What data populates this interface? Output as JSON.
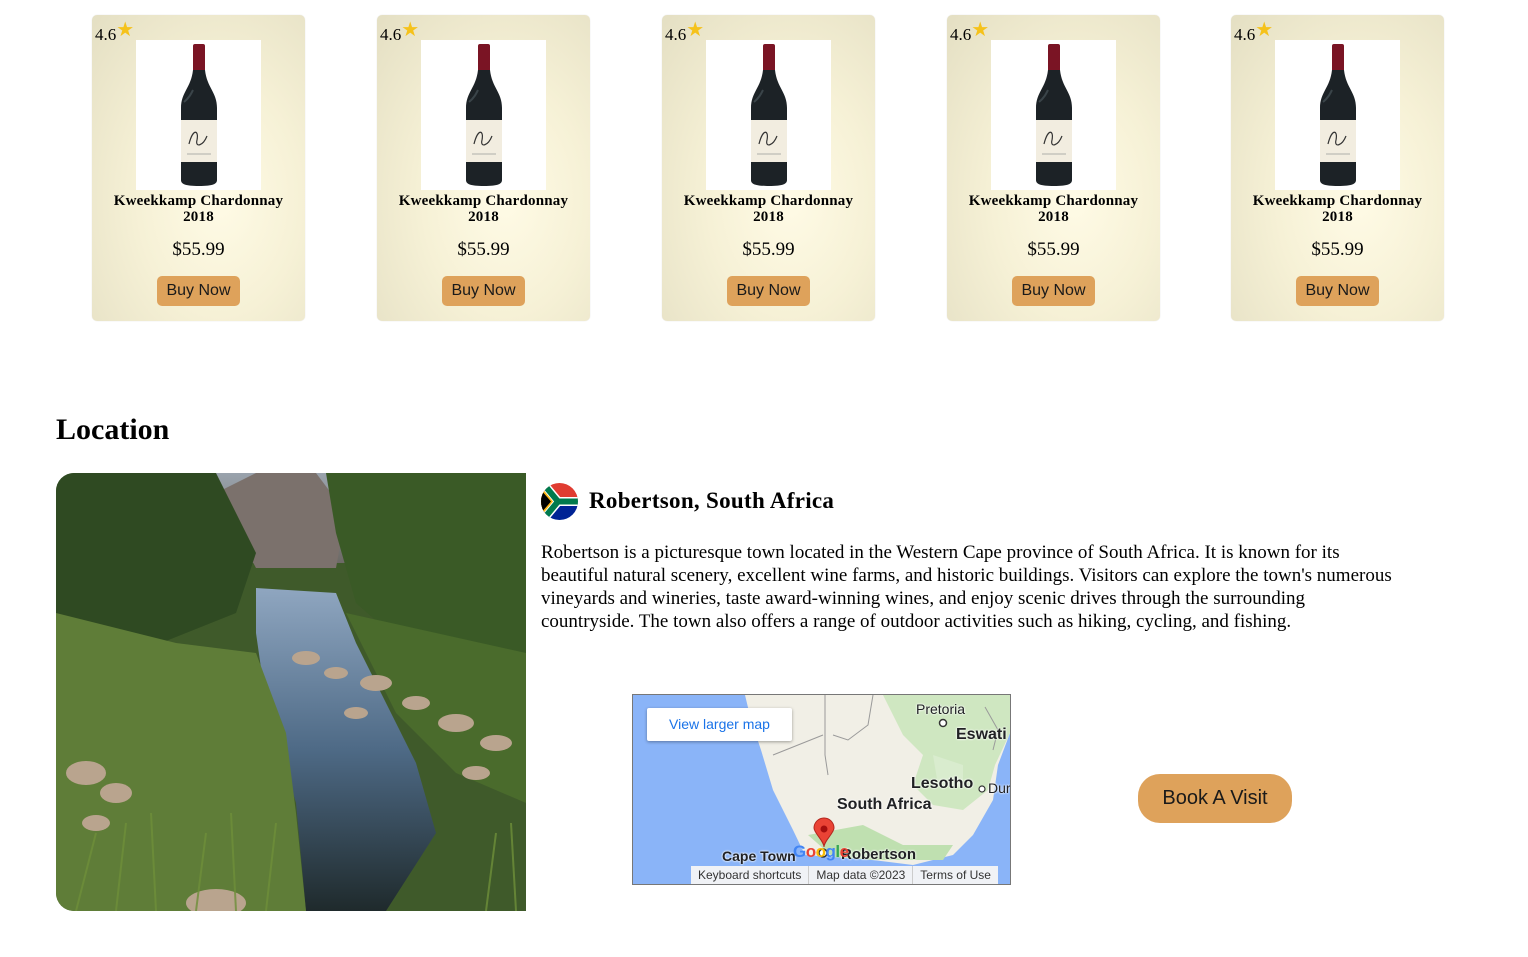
{
  "products": [
    {
      "rating": "4.6",
      "star": "★",
      "name": "Kweekkamp Chardonnay",
      "year": "2018",
      "price": "$55.99",
      "button": "Buy Now"
    },
    {
      "rating": "4.6",
      "star": "★",
      "name": "Kweekkamp Chardonnay",
      "year": "2018",
      "price": "$55.99",
      "button": "Buy Now"
    },
    {
      "rating": "4.6",
      "star": "★",
      "name": "Kweekkamp Chardonnay",
      "year": "2018",
      "price": "$55.99",
      "button": "Buy Now"
    },
    {
      "rating": "4.6",
      "star": "★",
      "name": "Kweekkamp Chardonnay",
      "year": "2018",
      "price": "$55.99",
      "button": "Buy Now"
    },
    {
      "rating": "4.6",
      "star": "★",
      "name": "Kweekkamp Chardonnay",
      "year": "2018",
      "price": "$55.99",
      "button": "Buy Now"
    }
  ],
  "location": {
    "heading": "Location",
    "town": "Robertson, South Africa",
    "description": "Robertson is a picturesque town located in the Western Cape province of South Africa. It is known for its beautiful natural scenery, excellent wine farms, and historic buildings. Visitors can explore the town's numerous vineyards and wineries, taste award-winning wines, and enjoy scenic drives through the surrounding countryside. The town also offers a range of outdoor activities such as hiking, cycling, and fishing.",
    "book_button": "Book A Visit"
  },
  "map": {
    "larger_map_link": "View larger map",
    "labels": {
      "pretoria": "Pretoria",
      "eswatini": "Eswati",
      "lesotho": "Lesotho",
      "durban": "Dur",
      "south_africa": "South Africa",
      "cape_town": "Cape Town",
      "robertson": "Robertson"
    },
    "logo": "Google",
    "footer": {
      "shortcuts": "Keyboard shortcuts",
      "map_data": "Map data ©2023",
      "terms": "Terms of Use"
    }
  },
  "colors": {
    "button": "#dea25b",
    "star": "#f5c21b",
    "link": "#1a73e8"
  }
}
